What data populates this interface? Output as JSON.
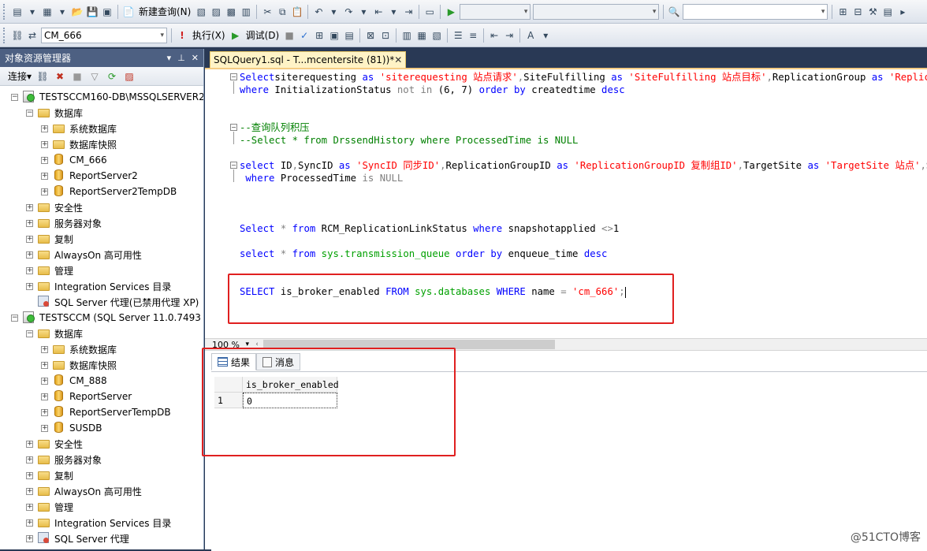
{
  "toolbar1": {
    "new_query_label": "新建查询(N)"
  },
  "toolbar2": {
    "database_select": "CM_666",
    "execute_label": "执行(X)",
    "debug_label": "调试(D)"
  },
  "object_explorer": {
    "title": "对象资源管理器",
    "title_controls": [
      "▾",
      "ᵖ",
      "✕"
    ],
    "connect_label": "连接",
    "tree": [
      {
        "label": "TESTSCCM160-DB\\MSSQLSERVER2",
        "level": 0,
        "icon": "server-icon",
        "exp": "−"
      },
      {
        "label": "数据库",
        "level": 1,
        "icon": "folder-icon",
        "exp": "−"
      },
      {
        "label": "系统数据库",
        "level": 2,
        "icon": "folder-icon",
        "exp": "+"
      },
      {
        "label": "数据库快照",
        "level": 2,
        "icon": "folder-icon",
        "exp": "+"
      },
      {
        "label": "CM_666",
        "level": 2,
        "icon": "database-icon",
        "exp": "+"
      },
      {
        "label": "ReportServer2",
        "level": 2,
        "icon": "database-icon",
        "exp": "+"
      },
      {
        "label": "ReportServer2TempDB",
        "level": 2,
        "icon": "database-icon",
        "exp": "+"
      },
      {
        "label": "安全性",
        "level": 1,
        "icon": "folder-icon",
        "exp": "+"
      },
      {
        "label": "服务器对象",
        "level": 1,
        "icon": "folder-icon",
        "exp": "+"
      },
      {
        "label": "复制",
        "level": 1,
        "icon": "folder-icon",
        "exp": "+"
      },
      {
        "label": "AlwaysOn 高可用性",
        "level": 1,
        "icon": "folder-icon",
        "exp": "+"
      },
      {
        "label": "管理",
        "level": 1,
        "icon": "folder-icon",
        "exp": "+"
      },
      {
        "label": "Integration Services 目录",
        "level": 1,
        "icon": "folder-icon",
        "exp": "+"
      },
      {
        "label": "SQL Server 代理(已禁用代理 XP)",
        "level": 1,
        "icon": "agent-icon",
        "exp": ""
      },
      {
        "label": "TESTSCCM (SQL Server 11.0.7493 -",
        "level": 0,
        "icon": "server-icon",
        "exp": "−"
      },
      {
        "label": "数据库",
        "level": 1,
        "icon": "folder-icon",
        "exp": "−"
      },
      {
        "label": "系统数据库",
        "level": 2,
        "icon": "folder-icon",
        "exp": "+"
      },
      {
        "label": "数据库快照",
        "level": 2,
        "icon": "folder-icon",
        "exp": "+"
      },
      {
        "label": "CM_888",
        "level": 2,
        "icon": "database-icon",
        "exp": "+"
      },
      {
        "label": "ReportServer",
        "level": 2,
        "icon": "database-icon",
        "exp": "+"
      },
      {
        "label": "ReportServerTempDB",
        "level": 2,
        "icon": "database-icon",
        "exp": "+"
      },
      {
        "label": "SUSDB",
        "level": 2,
        "icon": "database-icon",
        "exp": "+"
      },
      {
        "label": "安全性",
        "level": 1,
        "icon": "folder-icon",
        "exp": "+"
      },
      {
        "label": "服务器对象",
        "level": 1,
        "icon": "folder-icon",
        "exp": "+"
      },
      {
        "label": "复制",
        "level": 1,
        "icon": "folder-icon",
        "exp": "+"
      },
      {
        "label": "AlwaysOn 高可用性",
        "level": 1,
        "icon": "folder-icon",
        "exp": "+"
      },
      {
        "label": "管理",
        "level": 1,
        "icon": "folder-icon",
        "exp": "+"
      },
      {
        "label": "Integration Services 目录",
        "level": 1,
        "icon": "folder-icon",
        "exp": "+"
      },
      {
        "label": "SQL Server 代理",
        "level": 1,
        "icon": "agent-icon",
        "exp": "+"
      }
    ]
  },
  "query_tab": {
    "title": "SQLQuery1.sql - T...mcentersite (81))*",
    "close": "✕"
  },
  "editor": {
    "lines": {
      "l1": [
        [
          "kw",
          "Select"
        ],
        [
          "",
          "siterequesting "
        ],
        [
          "kw",
          "as"
        ],
        [
          "str",
          " 'siterequesting 站点请求'"
        ],
        [
          "gr",
          ","
        ],
        [
          "",
          "SiteFulfilling "
        ],
        [
          "kw",
          "as"
        ],
        [
          "str",
          " 'SiteFulfilling 站点目标'"
        ],
        [
          "gr",
          ","
        ],
        [
          "",
          "ReplicationGroup "
        ],
        [
          "kw",
          "as"
        ],
        [
          "str",
          " 'Replicati"
        ]
      ],
      "l2": [
        [
          "kw",
          "where"
        ],
        [
          "",
          " InitializationStatus "
        ],
        [
          "gr",
          "not in"
        ],
        [
          "",
          " (6, 7) "
        ],
        [
          "kw",
          "order by"
        ],
        [
          "",
          " createdtime "
        ],
        [
          "kw",
          "desc"
        ]
      ],
      "l3": [
        [
          "cm",
          "--查询队列积压"
        ]
      ],
      "l4": [
        [
          "cm",
          "--Select * from DrssendHistory where ProcessedTime is NULL"
        ]
      ],
      "l5": [
        [
          "kw",
          "select"
        ],
        [
          "",
          " ID"
        ],
        [
          "gr",
          ","
        ],
        [
          "",
          "SyncID "
        ],
        [
          "kw",
          "as"
        ],
        [
          "str",
          " 'SyncID 同步ID'"
        ],
        [
          "gr",
          ","
        ],
        [
          "",
          "ReplicationGroupID "
        ],
        [
          "kw",
          "as"
        ],
        [
          "str",
          " 'ReplicationGroupID 复制组ID'"
        ],
        [
          "gr",
          ","
        ],
        [
          "",
          "TargetSite "
        ],
        [
          "kw",
          "as"
        ],
        [
          "str",
          " 'TargetSite 站点'"
        ],
        [
          "gr",
          ","
        ],
        [
          "",
          "Sendi"
        ]
      ],
      "l6": [
        [
          "kw",
          " where"
        ],
        [
          "",
          " ProcessedTime "
        ],
        [
          "gr",
          "is"
        ],
        [
          "gr",
          " NULL"
        ]
      ],
      "l7": [
        [
          "kw",
          "Select"
        ],
        [
          "gr",
          " *"
        ],
        [
          "kw",
          " from"
        ],
        [
          "",
          " RCM_ReplicationLinkStatus "
        ],
        [
          "kw",
          "where"
        ],
        [
          "",
          " snapshotapplied "
        ],
        [
          "gr",
          "<>"
        ],
        [
          "",
          "1"
        ]
      ],
      "l8": [
        [
          "kw",
          "select"
        ],
        [
          "gr",
          " *"
        ],
        [
          "kw",
          " from"
        ],
        [
          "sys",
          " sys.transmission_queue"
        ],
        [
          "kw",
          " order by"
        ],
        [
          "",
          " enqueue_time "
        ],
        [
          "kw",
          "desc"
        ]
      ],
      "l9": [
        [
          "kw",
          "SELECT"
        ],
        [
          "",
          " is_broker_enabled "
        ],
        [
          "kw",
          "FROM"
        ],
        [
          "sys",
          " sys.databases"
        ],
        [
          "kw",
          " WHERE"
        ],
        [
          "",
          " name "
        ],
        [
          "gr",
          "="
        ],
        [
          "str",
          " 'cm_666'"
        ],
        [
          "gr",
          ";"
        ]
      ]
    }
  },
  "zoom": {
    "value": "100 %"
  },
  "results": {
    "tab_results": "结果",
    "tab_messages": "消息",
    "column": "is_broker_enabled",
    "rows": [
      {
        "num": "1",
        "value": "0"
      }
    ]
  },
  "watermark": "@51CTO博客",
  "colors": {
    "keyword": "#0000ff",
    "string": "#ff0000",
    "comment": "#008000",
    "annotation": "#e02020"
  }
}
